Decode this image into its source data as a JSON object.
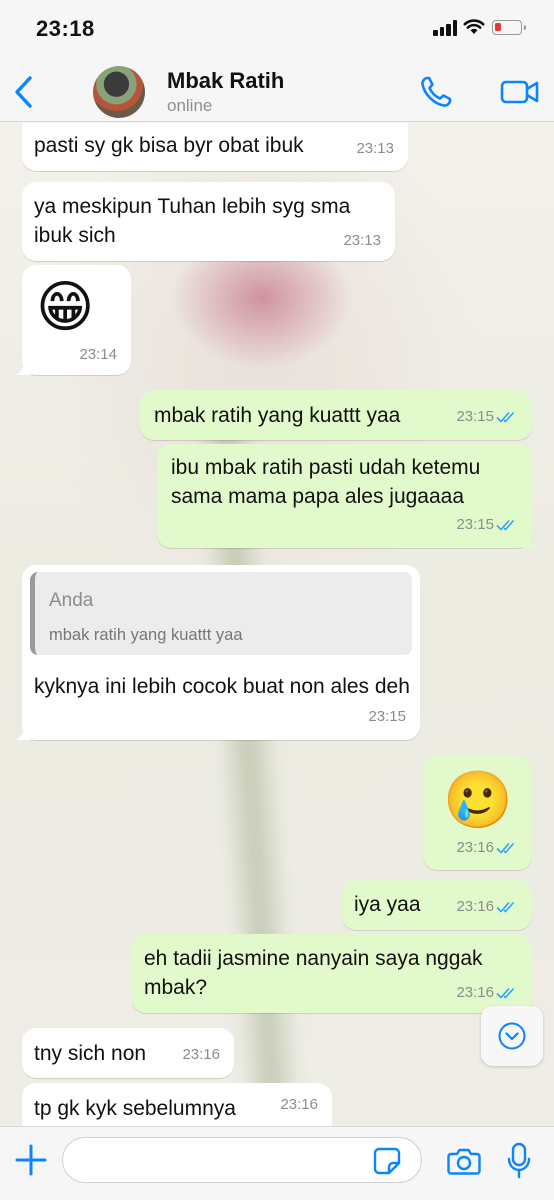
{
  "status_bar": {
    "time": "23:18",
    "battery_level": 0.25,
    "battery_color": "#e53935"
  },
  "header": {
    "back_icon": "chevron-left-icon",
    "contact_name": "Mbak Ratih",
    "contact_status": "online",
    "call_icon": "phone-icon",
    "video_icon": "video-camera-icon",
    "accent_color": "#0a84ff"
  },
  "messages": [
    {
      "dir": "in",
      "text": "pasti sy gk bisa byr obat ibuk",
      "time": "23:13"
    },
    {
      "dir": "in",
      "text": "ya meskipun Tuhan lebih syg sma ibuk sich",
      "time": "23:13"
    },
    {
      "dir": "in",
      "emoji": "😁",
      "time": "23:14"
    },
    {
      "dir": "out",
      "text": "mbak ratih yang kuattt yaa",
      "time": "23:15",
      "read": true
    },
    {
      "dir": "out",
      "text": "ibu mbak ratih pasti udah ketemu sama mama papa ales jugaaaa",
      "time": "23:15",
      "read": true
    },
    {
      "dir": "in",
      "quote_author": "Anda",
      "quote_text": "mbak ratih yang kuattt yaa",
      "text": "kyknya ini lebih cocok buat non ales deh",
      "time": "23:15"
    },
    {
      "dir": "out",
      "emoji": "🥲",
      "time": "23:16",
      "read": true
    },
    {
      "dir": "out",
      "text": "iya yaa",
      "time": "23:16",
      "read": true
    },
    {
      "dir": "out",
      "text": "eh tadii jasmine nanyain saya nggak mbak?",
      "time": "23:16",
      "read": true
    },
    {
      "dir": "in",
      "text": "tny sich non",
      "time": "23:16"
    },
    {
      "dir": "in",
      "text": "tp gk kyk sebelumnya",
      "time": "23:16"
    }
  ],
  "colors": {
    "incoming_bubble": "#ffffff",
    "outgoing_bubble": "#e1f9cb",
    "read_ticks": "#34a3f5"
  },
  "scroll_down_icon": "chevron-down-circle-icon",
  "composer": {
    "plus_icon": "plus-icon",
    "input_value": "",
    "sticker_icon": "sticker-icon",
    "camera_icon": "camera-icon",
    "mic_icon": "microphone-icon"
  }
}
